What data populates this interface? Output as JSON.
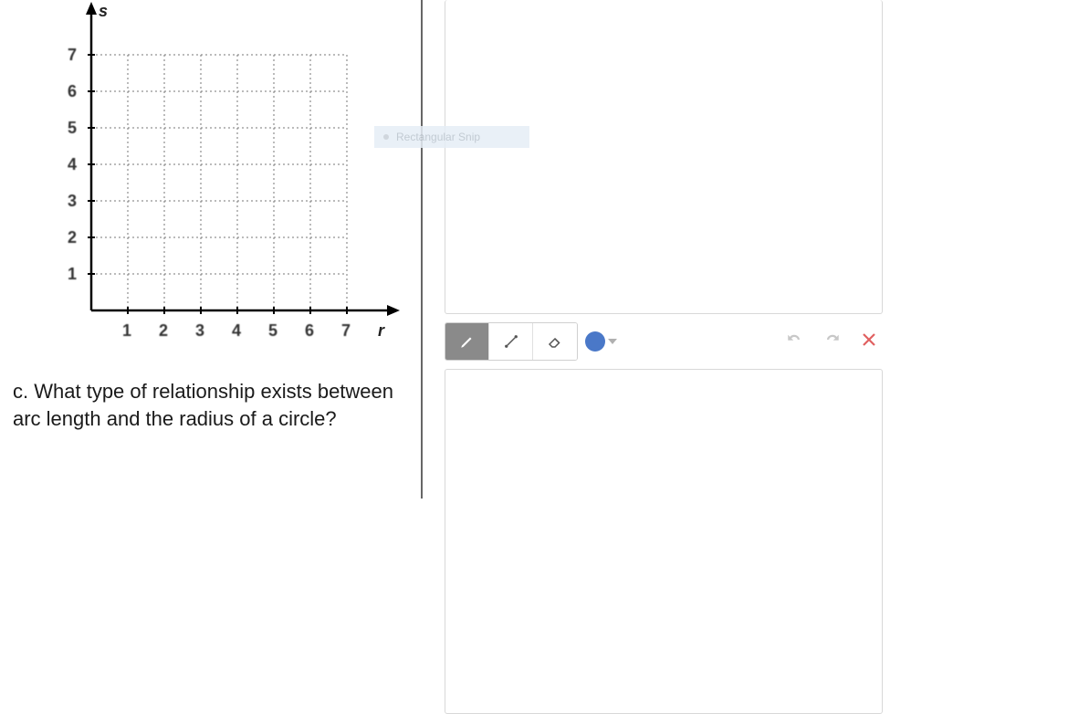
{
  "chart_data": {
    "type": "scatter",
    "title": "",
    "xlabel": "r",
    "ylabel": "s",
    "xlim": [
      0,
      7
    ],
    "ylim": [
      0,
      7
    ],
    "x_ticks": [
      1,
      2,
      3,
      4,
      5,
      6,
      7
    ],
    "y_ticks": [
      1,
      2,
      3,
      4,
      5,
      6,
      7
    ],
    "series": []
  },
  "question": {
    "label": "c.",
    "text": "What type of relationship exists between arc length and the radius of a circle?"
  },
  "toolbar": {
    "pencil": "pencil",
    "line": "line",
    "eraser": "eraser",
    "color": "#4a78c8",
    "undo": "undo",
    "redo": "redo",
    "clear": "clear"
  },
  "snip_hint": "Rectangular Snip"
}
